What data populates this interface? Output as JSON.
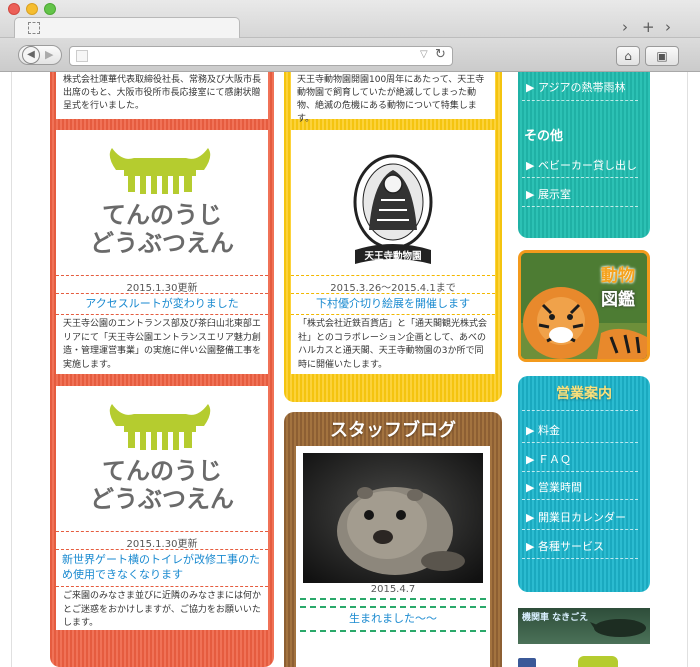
{
  "browser": {
    "new_tab_glyph": "+",
    "tab_menu_glyph": "›",
    "reader_glyph": "▽",
    "reload_glyph": "↻",
    "back_glyph": "◀",
    "forward_glyph": "▶",
    "home_glyph": "⌂",
    "bookmark_glyph": "▣"
  },
  "column_left": {
    "top_card_text": "株式会社蓮華代表取締役社長、常務及び大阪市長出席のもと、大阪市役所市長応接室にて感謝状贈呈式を行いました。",
    "news": [
      {
        "logo_line1": "てんのうじ",
        "logo_line2": "どうぶつえん",
        "date": "2015.1.30更新",
        "title": "アクセスルートが変わりました",
        "body": "天王寺公園のエントランス部及び茶臼山北東部エリアにて「天王寺公園エントランスエリア魅力創造・管理運営事業」の実施に伴い公園整備工事を実施します。"
      },
      {
        "logo_line1": "てんのうじ",
        "logo_line2": "どうぶつえん",
        "date": "2015.1.30更新",
        "title": "新世界ゲート横のトイレが改修工事のため使用できなくなります",
        "body": "ご来園のみなさま並びに近隣のみなさまには何かとご迷惑をおかけしますが、ご協力をお願いいたします。"
      }
    ]
  },
  "column_mid": {
    "top_card_text": "天王寺動物園開園100周年にあたって、天王寺動物園で飼育していたが絶滅してしまった動物、絶滅の危機にある動物について特集します。",
    "event": {
      "emblem_label": "天王寺動物園",
      "date": "2015.3.26～2015.4.1まで",
      "title": "下村優介切り絵展を開催します",
      "body": "「株式会社近鉄百貨店」と「通天閣観光株式会社」とのコラボレーション企画として、あべのハルカスと通天閣、天王寺動物園の3か所で同時に開催いたします。"
    },
    "blog": {
      "heading": "スタッフブログ",
      "date": "2015.4.7",
      "title": "生まれました〜〜"
    }
  },
  "column_right": {
    "menu_top": [
      {
        "label": "アジアの熱帯雨林"
      }
    ],
    "other_heading": "その他",
    "menu_other": [
      {
        "label": "ベビーカー貸し出し"
      },
      {
        "label": "展示室"
      }
    ],
    "zukan": {
      "line1": "動物",
      "line2": "図鑑"
    },
    "info_heading": "営業案内",
    "menu_info": [
      {
        "label": "料金"
      },
      {
        "label": "ＦＡＱ"
      },
      {
        "label": "営業時間"
      },
      {
        "label": "開業日カレンダー"
      },
      {
        "label": "各種サービス"
      }
    ],
    "banner_text": "機関車 なきごえ"
  },
  "colors": {
    "red": "#e55c3f",
    "yellow": "#f4c40f",
    "brown": "#8d5f33",
    "teal": "#1fb1a5",
    "cyan": "#1aa9bf",
    "lime": "#b5cc2f",
    "link": "#1a8ad0"
  }
}
